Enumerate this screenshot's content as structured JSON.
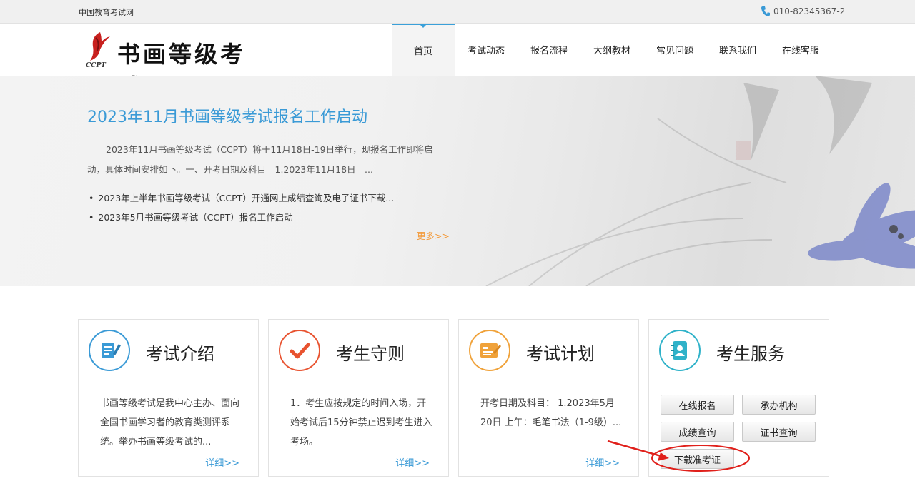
{
  "topbar": {
    "site_name": "中国教育考试网",
    "phone": "010-82345367-2",
    "phone_icon": "phone-icon"
  },
  "logo": {
    "title": "书画等级考试",
    "mark_text": "CCPT"
  },
  "nav": {
    "items": [
      {
        "label": "首页",
        "active": true
      },
      {
        "label": "考试动态"
      },
      {
        "label": "报名流程"
      },
      {
        "label": "大纲教材"
      },
      {
        "label": "常见问题"
      },
      {
        "label": "联系我们"
      },
      {
        "label": "在线客服"
      }
    ]
  },
  "banner": {
    "headline": "2023年11月书画等级考试报名工作启动",
    "summary": "2023年11月书画等级考试（CCPT）将于11月18日-19日举行，现报名工作即将启动，具体时间安排如下。一、开考日期及科目　1.2023年11月18日　...",
    "news": [
      "2023年上半年书画等级考试（CCPT）开通网上成绩查询及电子证书下载...",
      "2023年5月书画等级考试（CCPT）报名工作启动"
    ],
    "more_label": "更多>>"
  },
  "cards": [
    {
      "title": "考试介绍",
      "icon": "document-edit-icon",
      "body": "书画等级考试是我中心主办、面向全国书画学习者的教育类测评系统。举办书画等级考试的...",
      "detail": "详细>>"
    },
    {
      "title": "考生守则",
      "icon": "checkmark-icon",
      "body": "1．考生应按规定的时间入场，开始考试后15分钟禁止迟到考生进入考场。",
      "detail": "详细>>"
    },
    {
      "title": "考试计划",
      "icon": "schedule-icon",
      "body": "开考日期及科目：  1.2023年5月20日 上午：毛笔书法（1-9级）...",
      "detail": "详细>>"
    },
    {
      "title": "考生服务",
      "icon": "address-book-icon",
      "buttons": [
        "在线报名",
        "承办机构",
        "成绩查询",
        "证书查询",
        "下载准考证"
      ]
    }
  ],
  "colors": {
    "accent": "#3a9ad6",
    "more": "#f39a3a",
    "annotation": "#e0201b"
  }
}
